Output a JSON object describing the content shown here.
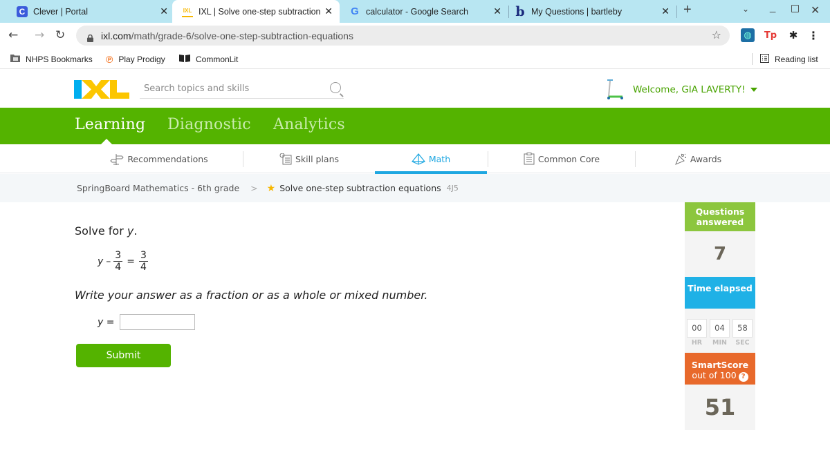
{
  "browser": {
    "tabs": [
      {
        "title": "Clever | Portal",
        "icon": "clever-icon",
        "active": false
      },
      {
        "title": "IXL | Solve one-step subtraction e",
        "icon": "ixl-icon",
        "active": true
      },
      {
        "title": "calculator - Google Search",
        "icon": "google-icon",
        "active": false
      },
      {
        "title": "My Questions | bartleby",
        "icon": "bartleby-icon",
        "active": false
      }
    ],
    "new_tab": "+",
    "url_domain": "ixl.com",
    "url_path": "/math/grade-6/solve-one-step-subtraction-equations",
    "bookmarks": [
      {
        "label": "NHPS Bookmarks",
        "icon": "folder-icon"
      },
      {
        "label": "Play Prodigy",
        "icon": "prodigy-icon"
      },
      {
        "label": "CommonLit",
        "icon": "book-icon"
      }
    ],
    "reading_list": "Reading list"
  },
  "ixl": {
    "search_placeholder": "Search topics and skills",
    "welcome": "Welcome, GIA LAVERTY!",
    "main_nav": [
      "Learning",
      "Diagnostic",
      "Analytics"
    ],
    "sub_nav": [
      {
        "label": "Recommendations",
        "icon": "signpost-icon"
      },
      {
        "label": "Skill plans",
        "icon": "checklist-icon"
      },
      {
        "label": "Math",
        "icon": "pyramid-icon",
        "active": true
      },
      {
        "label": "Common Core",
        "icon": "clipboard-icon"
      },
      {
        "label": "Awards",
        "icon": "party-popper-icon"
      }
    ],
    "breadcrumb": {
      "parent": "SpringBoard Mathematics - 6th grade",
      "separator": ">",
      "current": "Solve one-step subtraction equations",
      "code": "4J5"
    }
  },
  "question": {
    "prompt_prefix": "Solve for ",
    "prompt_var": "y",
    "prompt_suffix": ".",
    "equation": {
      "lhs_var": "y",
      "op": "–",
      "lhs_num": "3",
      "lhs_den": "4",
      "eq": "=",
      "rhs_num": "3",
      "rhs_den": "4"
    },
    "instructions": "Write your answer as a fraction or as a whole or mixed number.",
    "answer_label": "y =",
    "answer_value": "",
    "submit_label": "Submit"
  },
  "stats": {
    "questions_answered_label": "Questions answered",
    "questions_answered": "7",
    "time_elapsed_label": "Time elapsed",
    "time": {
      "hr": "00",
      "min": "04",
      "sec": "58"
    },
    "time_units": {
      "hr": "HR",
      "min": "MIN",
      "sec": "SEC"
    },
    "smartscore_label": "SmartScore",
    "smartscore_sub": "out of 100",
    "smartscore": "51"
  },
  "colors": {
    "ixl_green": "#54b300",
    "ixl_blue": "#1fb1e6",
    "questions_green": "#8cc63e",
    "smartscore_orange": "#e8692b",
    "tab_bar": "#b8e6f2"
  }
}
